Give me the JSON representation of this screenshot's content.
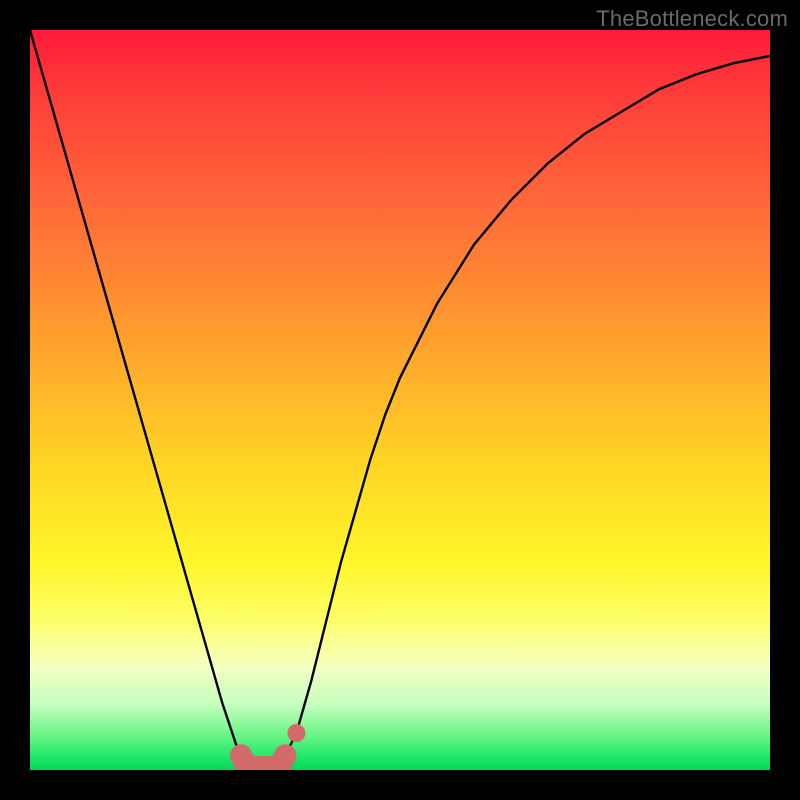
{
  "watermark": "TheBottleneck.com",
  "colors": {
    "frame": "#000000",
    "curve": "#000000",
    "marker": "#d36a6a",
    "gradient_stops": [
      "#ff1a3a",
      "#ff3a3a",
      "#ff643a",
      "#ff9a2f",
      "#ffd324",
      "#fff62a",
      "#fdff6a",
      "#f4ffc2",
      "#c7ffbf",
      "#70f68a",
      "#27e86a",
      "#00d85a"
    ]
  },
  "chart_data": {
    "type": "line",
    "title": "",
    "xlabel": "",
    "ylabel": "",
    "xlim": [
      0,
      100
    ],
    "ylim": [
      0,
      100
    ],
    "x": [
      0,
      2,
      4,
      6,
      8,
      10,
      12,
      14,
      16,
      18,
      20,
      22,
      24,
      26,
      28,
      29,
      30,
      31,
      32,
      33,
      34,
      36,
      38,
      40,
      42,
      44,
      46,
      48,
      50,
      55,
      60,
      65,
      70,
      75,
      80,
      85,
      90,
      95,
      100
    ],
    "values": [
      100,
      93,
      86,
      79,
      72,
      65,
      58,
      51,
      44,
      37,
      30,
      23,
      16,
      9,
      3,
      1,
      0,
      0,
      0,
      0,
      1,
      5,
      12,
      20,
      28,
      35,
      42,
      48,
      53,
      63,
      71,
      77,
      82,
      86,
      89,
      92,
      94,
      95.5,
      96.5
    ],
    "series": [
      {
        "name": "bottleneck-curve",
        "x": [
          0,
          2,
          4,
          6,
          8,
          10,
          12,
          14,
          16,
          18,
          20,
          22,
          24,
          26,
          28,
          29,
          30,
          31,
          32,
          33,
          34,
          36,
          38,
          40,
          42,
          44,
          46,
          48,
          50,
          55,
          60,
          65,
          70,
          75,
          80,
          85,
          90,
          95,
          100
        ],
        "values": [
          100,
          93,
          86,
          79,
          72,
          65,
          58,
          51,
          44,
          37,
          30,
          23,
          16,
          9,
          3,
          1,
          0,
          0,
          0,
          0,
          1,
          5,
          12,
          20,
          28,
          35,
          42,
          48,
          53,
          63,
          71,
          77,
          82,
          86,
          89,
          92,
          94,
          95.5,
          96.5
        ]
      }
    ],
    "marker_region": {
      "x_start": 28.5,
      "x_end": 34.5,
      "y_floor": 0,
      "style": "thick-rounded"
    },
    "marker_dot": {
      "x": 36,
      "y": 5
    }
  }
}
